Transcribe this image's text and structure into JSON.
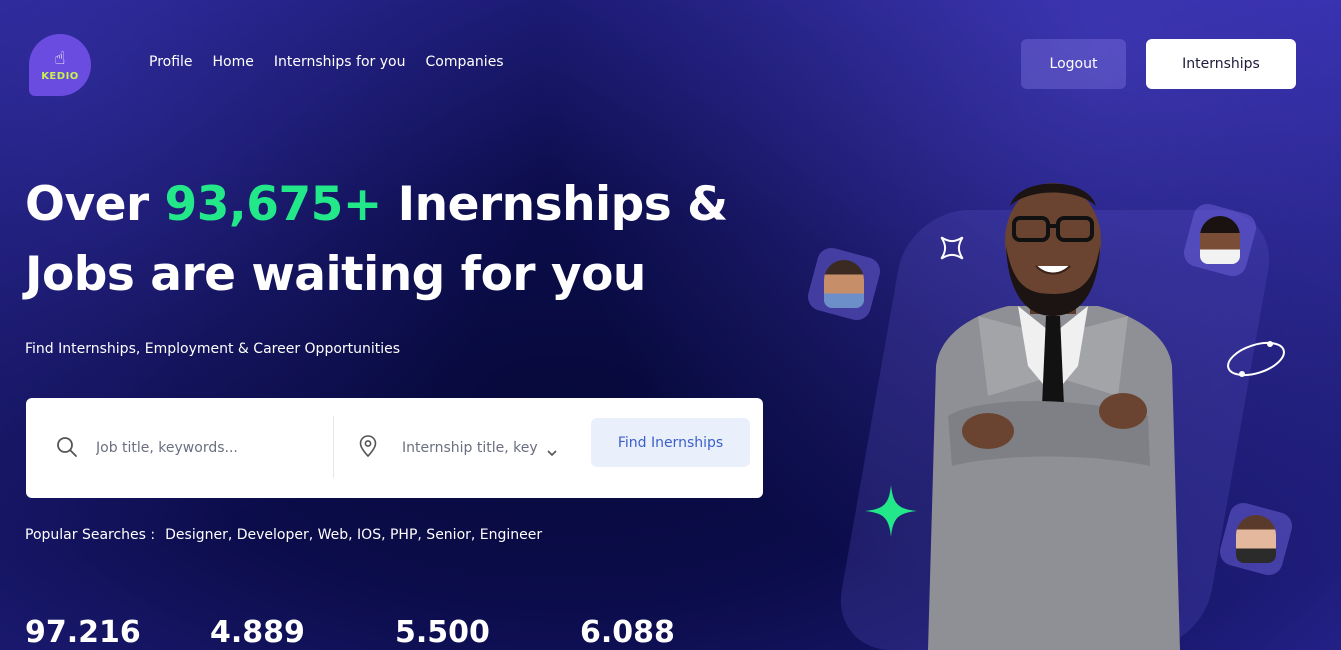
{
  "logo": {
    "text": "KEDIO"
  },
  "nav": {
    "items": [
      "Profile",
      "Home",
      "Internships for you",
      "Companies"
    ]
  },
  "header": {
    "logout_label": "Logout",
    "internships_label": "Internships"
  },
  "hero": {
    "headline_before": "Over ",
    "headline_number": "93,675+",
    "headline_after": " Inernships & Jobs are waiting for you",
    "subhead": "Find Internships, Employment & Career Opportunities"
  },
  "search": {
    "keyword_placeholder": "Job title, keywords...",
    "location_placeholder": "Internship title, key",
    "button_label": "Find Inernships"
  },
  "popular": {
    "label": "Popular Searches :",
    "terms": "Designer, Developer, Web, IOS, PHP, Senior, Engineer"
  },
  "stats": [
    "97.216",
    "4.889",
    "5.500",
    "6.088"
  ],
  "colors": {
    "accent_green": "#23e88a",
    "logo_bg": "#6b4ce0",
    "logo_text": "#c9f24e"
  },
  "icons": [
    "hand-pointer-icon",
    "search-icon",
    "location-pin-icon",
    "chevron-down-icon",
    "sparkle-icon",
    "star-outline-icon",
    "ring-icon"
  ]
}
